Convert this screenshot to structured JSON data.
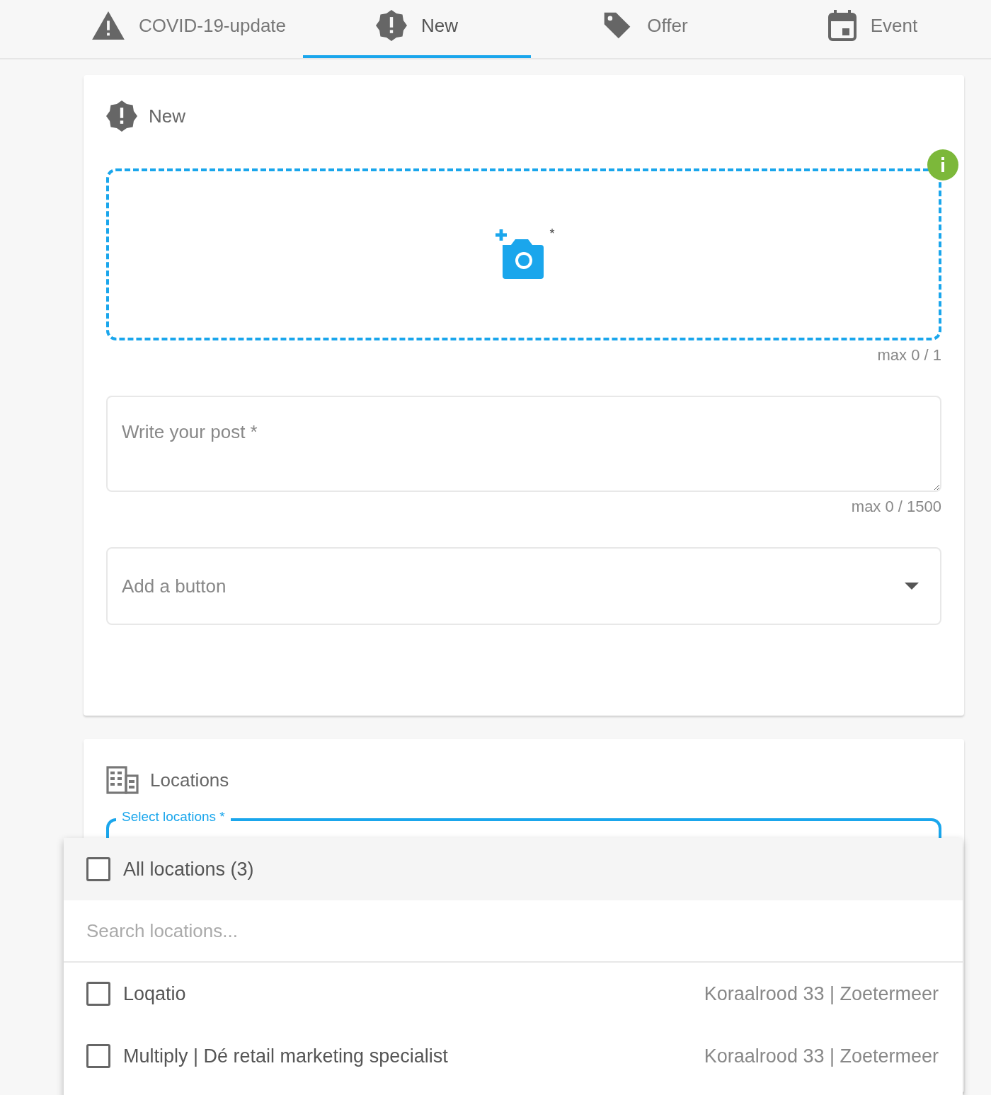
{
  "tabs": [
    {
      "kind": "warning",
      "label": "COVID-19-update",
      "selected": false
    },
    {
      "kind": "new",
      "label": "New",
      "selected": true
    },
    {
      "kind": "tag",
      "label": "Offer",
      "selected": false
    },
    {
      "kind": "calendar",
      "label": "Event",
      "selected": false
    }
  ],
  "post_card": {
    "title": "New",
    "upload": {
      "required_mark": "*",
      "counter": "max 0 / 1"
    },
    "post_field": {
      "placeholder": "Write your post *",
      "counter": "max 0 / 1500"
    },
    "button_select": {
      "placeholder": "Add a button"
    }
  },
  "locations_card": {
    "title": "Locations",
    "select": {
      "label": "Select locations *"
    }
  },
  "dropdown": {
    "all": {
      "label": "All locations (3)",
      "checked": false
    },
    "search": {
      "placeholder": "Search locations..."
    },
    "options": [
      {
        "name": "Loqatio",
        "address": "Koraalrood 33 | Zoetermeer",
        "checked": false
      },
      {
        "name": "Multiply | Dé retail marketing specialist",
        "address": "Koraalrood 33 | Zoetermeer",
        "checked": false
      }
    ]
  }
}
